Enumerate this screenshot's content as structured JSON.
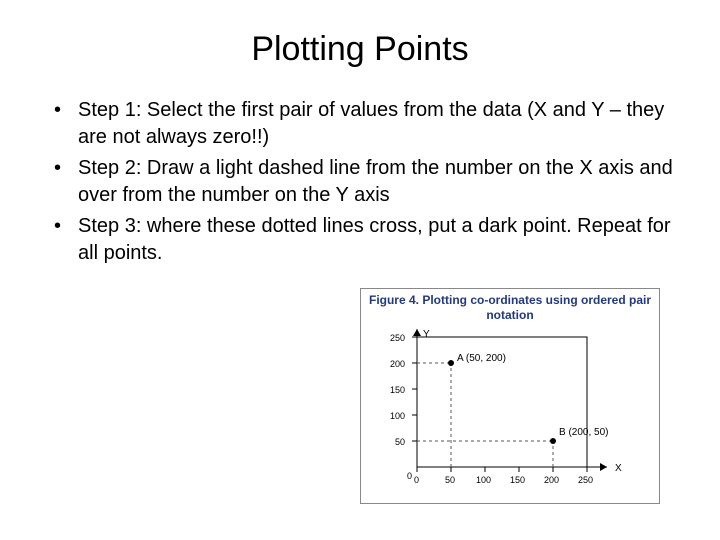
{
  "title": "Plotting Points",
  "bullets": {
    "b0": "Step 1:  Select the first pair of values from the data (X and Y – they are not always zero!!)",
    "b1": "Step 2: Draw a light dashed line from the number on the X axis and over from the number on the Y axis",
    "b2": "Step 3: where these dotted lines cross, put a dark point. Repeat for all points."
  },
  "figure": {
    "caption": "Figure 4. Plotting co-ordinates using ordered pair notation",
    "xlabel": "X",
    "ylabel": "Y",
    "origin": "0",
    "xticks": {
      "t0": "0",
      "t1": "50",
      "t2": "100",
      "t3": "150",
      "t4": "200",
      "t5": "250"
    },
    "yticks": {
      "t1": "50",
      "t2": "100",
      "t3": "150",
      "t4": "200",
      "t5": "250"
    },
    "ptA_label": "A (50, 200)",
    "ptB_label": "B (200, 50)"
  },
  "chart_data": {
    "type": "scatter",
    "title": "Figure 4. Plotting co-ordinates using ordered pair notation",
    "xlabel": "X",
    "ylabel": "Y",
    "xlim": [
      0,
      250
    ],
    "ylim": [
      0,
      250
    ],
    "x_ticks": [
      0,
      50,
      100,
      150,
      200,
      250
    ],
    "y_ticks": [
      0,
      50,
      100,
      150,
      200,
      250
    ],
    "series": [
      {
        "name": "A",
        "x": [
          50
        ],
        "y": [
          200
        ],
        "label": "A (50, 200)"
      },
      {
        "name": "B",
        "x": [
          200
        ],
        "y": [
          50
        ],
        "label": "B (200, 50)"
      }
    ],
    "guides": [
      {
        "from_axis": "x",
        "at": 50,
        "to_y": 200
      },
      {
        "from_axis": "y",
        "at": 200,
        "to_x": 50
      },
      {
        "from_axis": "x",
        "at": 200,
        "to_y": 50
      },
      {
        "from_axis": "y",
        "at": 50,
        "to_x": 200
      }
    ]
  }
}
